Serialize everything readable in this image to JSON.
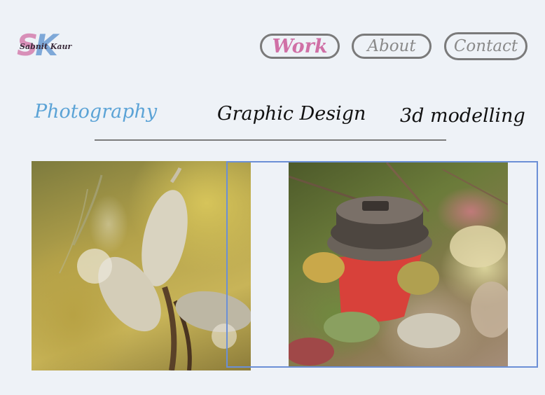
{
  "logo": {
    "initials_left": "S",
    "initials_right": "K",
    "name": "Sabnit Kaur"
  },
  "nav": {
    "work": "Work",
    "about": "About",
    "contact": "Contact"
  },
  "tabs": {
    "photography": "Photography",
    "graphic_design": "Graphic Design",
    "modelling": "3d modelling"
  },
  "colors": {
    "background": "#eef2f7",
    "accent_pink": "#d070a6",
    "accent_blue": "#5ba3d6",
    "selection_blue": "#6b8fd6"
  },
  "gallery": [
    {
      "subject": "milkweed pods"
    },
    {
      "subject": "coffee cup among leaves"
    }
  ]
}
